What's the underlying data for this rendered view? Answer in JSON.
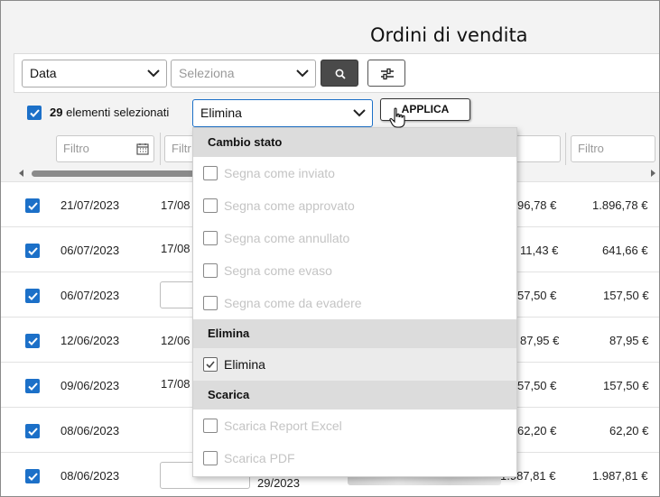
{
  "page": {
    "title": "Ordini di vendita"
  },
  "toolbar": {
    "date_select": "Data",
    "select_placeholder": "Seleziona",
    "search_icon": "search-icon",
    "filter_icon": "sliders-icon"
  },
  "selection": {
    "count": "29",
    "label": "elementi selezionati",
    "action_select": "Elimina",
    "apply_label": "APPLICA"
  },
  "filters": {
    "placeholder": "Filtro",
    "partial": "Filtr"
  },
  "dropdown": {
    "groups": [
      {
        "label": "Cambio stato",
        "items": [
          "Segna come inviato",
          "Segna come approvato",
          "Segna come annullato",
          "Segna come evaso",
          "Segna come da evadere"
        ]
      },
      {
        "label": "Elimina",
        "items": [
          "Elimina"
        ]
      },
      {
        "label": "Scarica",
        "items": [
          "Scarica Report Excel",
          "Scarica PDF"
        ]
      }
    ],
    "checked_item": "Elimina"
  },
  "rows": [
    {
      "date": "21/07/2023",
      "date2": "17/08",
      "amount_partial": "96,78 €",
      "total": "1.896,78 €"
    },
    {
      "date": "06/07/2023",
      "date2": "17/08",
      "amount_partial": "11,43 €",
      "total": "641,66 €"
    },
    {
      "date": "06/07/2023",
      "date2": "",
      "amount_partial": "57,50 €",
      "total": "157,50 €"
    },
    {
      "date": "12/06/2023",
      "date2": "12/06",
      "amount_partial": "87,95 €",
      "total": "87,95 €"
    },
    {
      "date": "09/06/2023",
      "date2": "17/08",
      "amount_partial": "57,50 €",
      "total": "157,50 €"
    },
    {
      "date": "08/06/2023",
      "date2": "",
      "amount_partial": "62,20 €",
      "total": "62,20 €"
    },
    {
      "date": "08/06/2023",
      "date2": "29/2023",
      "amount_partial": "1.987,81 €",
      "total": "1.987,81 €"
    }
  ],
  "colors": {
    "accent": "#1c70c8",
    "group_bg": "#dcdcdc",
    "disabled_text": "#c4c4c4"
  }
}
